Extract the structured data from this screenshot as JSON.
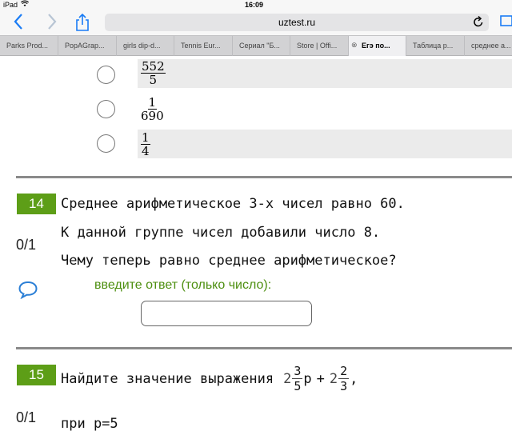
{
  "status_bar": {
    "device": "iPad",
    "wifi_icon": "wifi-icon",
    "time": "16:09"
  },
  "toolbar": {
    "back_icon": "back-arrow-icon",
    "forward_icon": "forward-arrow-icon",
    "share_icon": "share-icon",
    "url": "uztest.ru",
    "reload_icon": "reload-icon",
    "accent_color": "#1a7cf5"
  },
  "tabs": [
    {
      "label": "Parks Prod..."
    },
    {
      "label": "PopAGrap..."
    },
    {
      "label": "girls dip-d..."
    },
    {
      "label": "Tennis Eur..."
    },
    {
      "label": "Сериал \"Б..."
    },
    {
      "label": "Store | Offi..."
    },
    {
      "label": "Егэ по...",
      "active": true,
      "close": "⊗"
    },
    {
      "label": "Таблица р..."
    },
    {
      "label": "среднее а..."
    }
  ],
  "previous_options": [
    {
      "numerator": "552",
      "denominator": "5"
    },
    {
      "numerator": "1",
      "denominator": "690"
    },
    {
      "numerator": "1",
      "denominator": "4"
    }
  ],
  "q14": {
    "number": "14",
    "score": "0/1",
    "lines": [
      "Среднее арифметическое 3-х чисел равно 60.",
      "К данной группе чисел добавили число 8.",
      "Чему теперь равно среднее арифметическое?"
    ],
    "prompt": "введите ответ (только число):",
    "answer_value": "",
    "comment_icon": "speech-bubble-icon"
  },
  "q15": {
    "number": "15",
    "score": "0/1",
    "text": "Найдите значение выражения",
    "term1": {
      "whole": "2",
      "numerator": "3",
      "denominator": "5",
      "var": "p"
    },
    "operator": "+",
    "term2": {
      "whole": "2",
      "numerator": "2",
      "denominator": "3"
    },
    "trailing": ",",
    "line2": "при p=5"
  },
  "colors": {
    "question_badge": "#5d9e17",
    "prompt_text": "#4d8f10",
    "divider": "#8a8a8a"
  }
}
